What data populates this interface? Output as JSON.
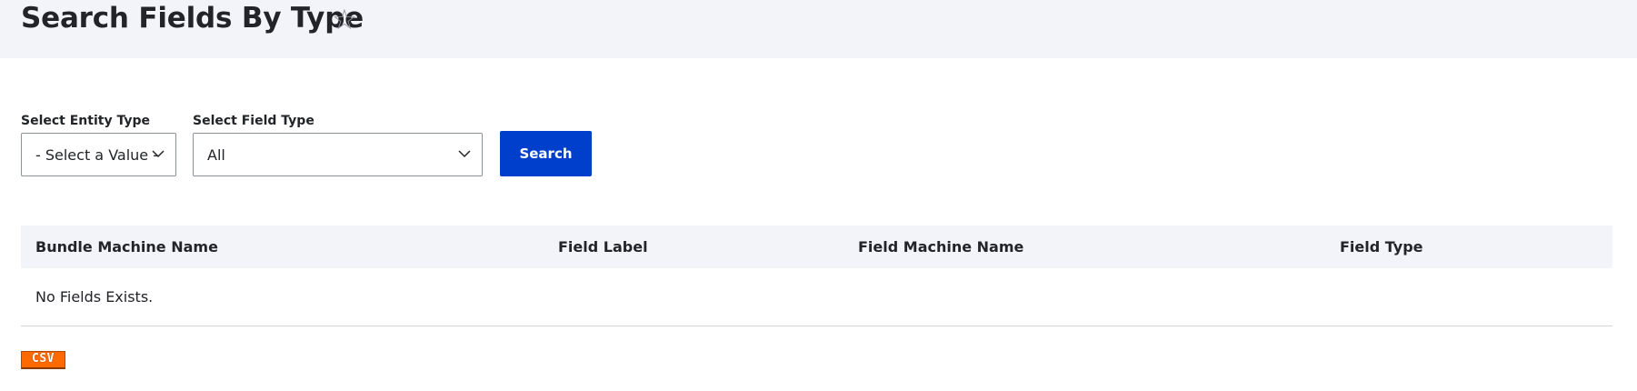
{
  "header": {
    "title": "Search Fields By Type",
    "favorite_icon": "star-outline-icon",
    "favorite_glyph": "☆"
  },
  "filters": {
    "entity_type": {
      "label": "Select Entity Type",
      "selected": "- Select a Value -"
    },
    "field_type": {
      "label": "Select Field Type",
      "selected": "All"
    },
    "search_label": "Search"
  },
  "table": {
    "columns": [
      "Bundle Machine Name",
      "Field Label",
      "Field Machine Name",
      "Field Type"
    ],
    "empty_message": "No Fields Exists."
  },
  "export": {
    "csv_label": "CSV"
  },
  "colors": {
    "header_bg": "#f3f4f9",
    "primary_button": "#003ecc",
    "csv_badge": "#ff6a00",
    "text": "#232429"
  }
}
